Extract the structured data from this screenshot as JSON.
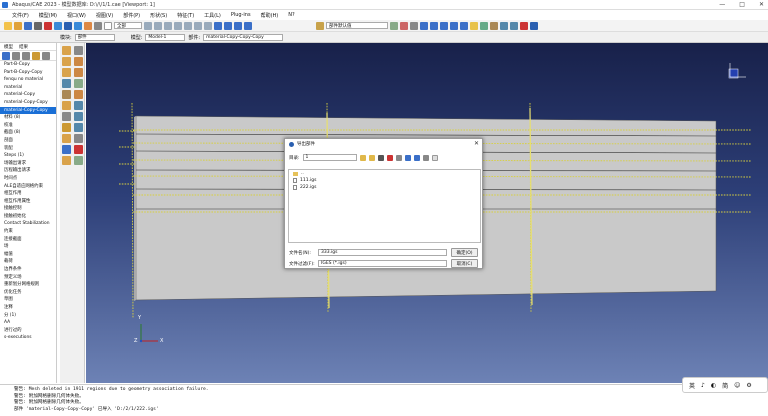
{
  "window": {
    "title": "Abaqus/CAE 2023 - 模型数据库: D:\\/\\/1/1.cae [Viewport: 1]",
    "controls": [
      "—",
      "□",
      "✕"
    ]
  },
  "menu": [
    "文件(F)",
    "模型(M)",
    "视口(W)",
    "视图(V)",
    "部件(P)",
    "形状(S)",
    "特征(T)",
    "工具(L)",
    "Plug-ins",
    "帮助(H)",
    "N?"
  ],
  "toolbar": {
    "render_style": "全部",
    "default_label": "部件默认值"
  },
  "context": {
    "module_label": "模块:",
    "module_value": "部件",
    "model_label": "模型:",
    "model_value": "Model-1",
    "part_label": "部件:",
    "part_value": "material-Copy-Copy-Copy"
  },
  "tree": {
    "tabs": [
      "模型",
      "结果"
    ],
    "items": [
      "Part-B-Copy",
      "Part-B-Copy-Copy",
      "fenqu no material",
      "material",
      "material-Copy",
      "material-Copy-Copy",
      "material-Copy-Copy",
      "材料 (8)",
      "校准",
      "截面 (8)",
      "剖面",
      "装配",
      "Steps (1)",
      "场输出请求",
      "历程输出请求",
      "时间点",
      "ALE自适应网格约束",
      "相互作用",
      "相互作用属性",
      "接触控制",
      "接触初始化",
      "Contact Stabilization",
      "约束",
      "连接截面",
      "场",
      "幅值",
      "载荷",
      "边界条件",
      "预定义场",
      "重新划分网格规则",
      "优化任务",
      "草图",
      "",
      "注释",
      "",
      "分 (1)",
      "AA",
      "进行过的",
      "s-executions"
    ],
    "selected_index": 6
  },
  "dialog": {
    "title": "导出部件",
    "lookin_label": "目录:",
    "lookin_value": "1",
    "files": [
      {
        "name": "..",
        "type": "folder"
      },
      {
        "name": "111.igs",
        "type": "file"
      },
      {
        "name": "222.igs",
        "type": "file"
      }
    ],
    "filename_label": "文件名(N):",
    "filename_value": "333.igs",
    "filter_label": "文件过滤(F):",
    "filter_value": "IGES (*.igs)",
    "ok_label": "确定(O)",
    "cancel_label": "取消(C)",
    "close": "✕"
  },
  "messages": [
    "警告: Mesh deleted in 1911 regions due to geometry association failure.",
    "警告: 附加网格删除几何体失败。",
    "警告: 附加网格删除几何体失败。",
    "部件 'material-Copy-Copy-Copy' 已导入 'D:/2/1/222.igs'"
  ],
  "ime": [
    "英",
    "♪",
    "◐",
    "简",
    "☺",
    "⚙"
  ],
  "triad": {
    "x": "X",
    "y": "Y",
    "z": "Z"
  }
}
